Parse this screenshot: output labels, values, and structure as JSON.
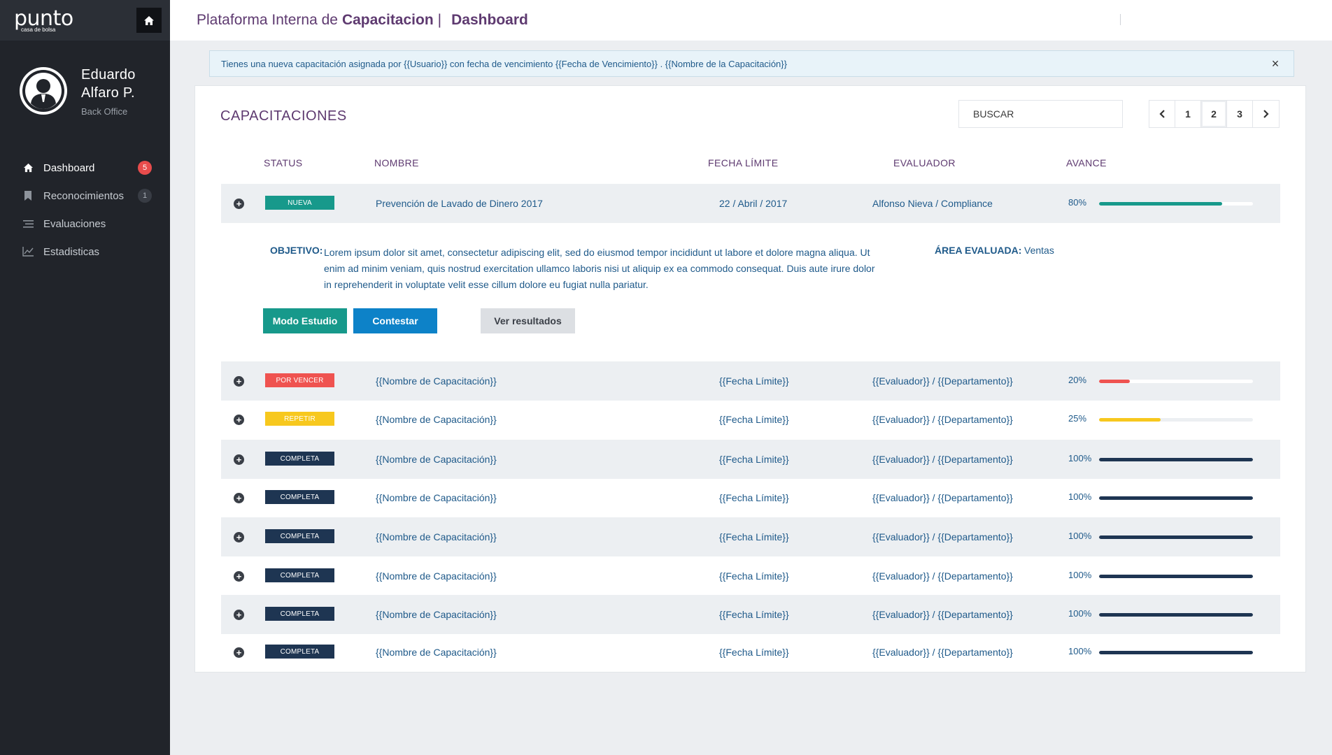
{
  "brand": {
    "logo_word": "punto",
    "logo_sub": "casa de bolsa"
  },
  "user": {
    "name_line1": "Eduardo",
    "name_line2": "Alfaro P.",
    "role": "Back Office"
  },
  "sidebar": {
    "items": [
      {
        "label": "Dashboard",
        "icon": "home-icon",
        "badge": "5",
        "badge_style": "red"
      },
      {
        "label": "Reconocimientos",
        "icon": "bookmark-icon",
        "badge": "1",
        "badge_style": "dark"
      },
      {
        "label": "Evaluaciones",
        "icon": "list-icon",
        "badge": ""
      },
      {
        "label": "Estadisticas",
        "icon": "chart-icon",
        "badge": ""
      }
    ]
  },
  "header": {
    "title_prefix": "Plataforma Interna de",
    "title_bold": "Capacitacion",
    "separator": "|",
    "page": "Dashboard"
  },
  "alert": {
    "message": "Tienes una nueva capacitación asignada por {{Usuario}} con fecha de vencimiento {{Fecha de Vencimiento}} . {{Nombre de la Capacitación}}",
    "close": "×"
  },
  "card": {
    "title": "CAPACITACIONES",
    "search_placeholder": "BUSCAR",
    "pager": {
      "prev": "‹",
      "pages": [
        "1",
        "2",
        "3"
      ],
      "current": "2",
      "next": "›"
    }
  },
  "table": {
    "headers": {
      "status": "STATUS",
      "nombre": "NOMBRE",
      "fecha": "FECHA LÍMITE",
      "evaluador": "EVALUADOR",
      "avance": "AVANCE"
    },
    "rows": [
      {
        "status": "NUEVA",
        "status_color": "#17998b",
        "nombre": "Prevención de Lavado de Dinero 2017",
        "fecha": "22 / Abril / 2017",
        "evaluador": "Alfonso Nieva / Compliance",
        "avance_label": "80%",
        "avance": 0.8,
        "bar_color": "#17998b"
      },
      {
        "status": "POR VENCER",
        "status_color": "#ef5350",
        "nombre": "{{Nombre de Capacitación}}",
        "fecha": "{{Fecha Límite}}",
        "evaluador": "{{Evaluador}} / {{Departamento}}",
        "avance_label": "20%",
        "avance": 0.2,
        "bar_color": "#ef5350"
      },
      {
        "status": "REPETIR",
        "status_color": "#f7c81e",
        "nombre": "{{Nombre de Capacitación}}",
        "fecha": "{{Fecha Límite}}",
        "evaluador": "{{Evaluador}} / {{Departamento}}",
        "avance_label": "25%",
        "avance": 0.4,
        "bar_color": "#f7c81e"
      },
      {
        "status": "COMPLETA",
        "status_color": "#1e3552",
        "nombre": "{{Nombre de Capacitación}}",
        "fecha": "{{Fecha Límite}}",
        "evaluador": "{{Evaluador}} / {{Departamento}}",
        "avance_label": "100%",
        "avance": 1.0,
        "bar_color": "#1e3552"
      },
      {
        "status": "COMPLETA",
        "status_color": "#1e3552",
        "nombre": "{{Nombre de Capacitación}}",
        "fecha": "{{Fecha Límite}}",
        "evaluador": "{{Evaluador}} / {{Departamento}}",
        "avance_label": "100%",
        "avance": 1.0,
        "bar_color": "#1e3552"
      },
      {
        "status": "COMPLETA",
        "status_color": "#1e3552",
        "nombre": "{{Nombre de Capacitación}}",
        "fecha": "{{Fecha Límite}}",
        "evaluador": "{{Evaluador}} / {{Departamento}}",
        "avance_label": "100%",
        "avance": 1.0,
        "bar_color": "#1e3552"
      },
      {
        "status": "COMPLETA",
        "status_color": "#1e3552",
        "nombre": "{{Nombre de Capacitación}}",
        "fecha": "{{Fecha Límite}}",
        "evaluador": "{{Evaluador}} / {{Departamento}}",
        "avance_label": "100%",
        "avance": 1.0,
        "bar_color": "#1e3552"
      },
      {
        "status": "COMPLETA",
        "status_color": "#1e3552",
        "nombre": "{{Nombre de Capacitación}}",
        "fecha": "{{Fecha Límite}}",
        "evaluador": "{{Evaluador}} / {{Departamento}}",
        "avance_label": "100%",
        "avance": 1.0,
        "bar_color": "#1e3552"
      },
      {
        "status": "COMPLETA",
        "status_color": "#1e3552",
        "nombre": "{{Nombre de Capacitación}}",
        "fecha": "{{Fecha Límite}}",
        "evaluador": "{{Evaluador}} / {{Departamento}}",
        "avance_label": "100%",
        "avance": 1.0,
        "bar_color": "#1e3552"
      }
    ]
  },
  "detail": {
    "objetivo_label": "OBJETIVO:",
    "objetivo_text": "Lorem ipsum dolor sit amet, consectetur adipiscing elit, sed do eiusmod tempor incididunt ut labore et dolore magna aliqua. Ut enim ad minim veniam, quis nostrud exercitation ullamco laboris nisi ut aliquip ex ea commodo consequat. Duis aute irure dolor in reprehenderit in voluptate velit esse cillum dolore eu fugiat nulla pariatur.",
    "area_label": "ÁREA EVALUADA:",
    "area_value": "Ventas",
    "buttons": {
      "study": "Modo Estudio",
      "answer": "Contestar",
      "results": "Ver resultados"
    }
  },
  "colors": {
    "sidebar_bg": "#21242a",
    "accent_purple": "#5e3a70",
    "text_blue": "#1f5a8a",
    "teal": "#17998b",
    "blue": "#0d82c8"
  }
}
